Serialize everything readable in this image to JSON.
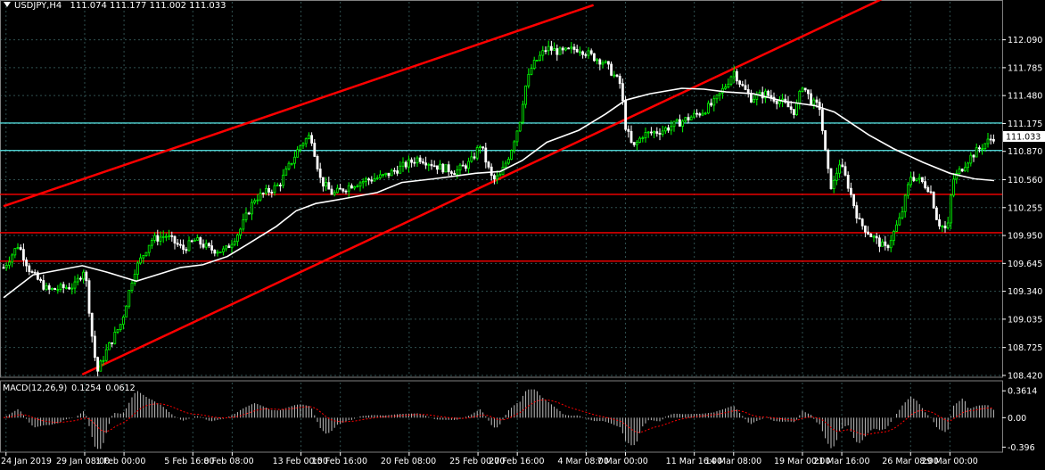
{
  "header": {
    "symbol": "USDJPY,H4",
    "open": "111.074",
    "high": "111.177",
    "low": "111.002",
    "close": "111.033"
  },
  "colors": {
    "background": "#000000",
    "grid": "#2f4f4f",
    "bull_candle": "#00ff00",
    "bear_candle": "#ffffff",
    "trendline": "#ff0000",
    "support": "#ff0000",
    "resistance": "#4fd1d1",
    "moving_average": "#ffffff",
    "macd_hist": "#c0c0c0",
    "macd_signal": "#ff0000",
    "text": "#ffffff",
    "price_tag": "#ffffff"
  },
  "chart_data": {
    "type": "candlestick",
    "symbol": "USDJPY",
    "timeframe": "H4",
    "y_ticks": [
      "112.090",
      "111.785",
      "111.480",
      "111.175",
      "110.870",
      "110.560",
      "110.255",
      "109.950",
      "109.645",
      "109.340",
      "109.035",
      "108.725",
      "108.420"
    ],
    "ylim": [
      108.4,
      112.33
    ],
    "x_ticks": [
      "24 Jan 2019",
      "29 Jan 08:00",
      "1 Feb 00:00",
      "5 Feb 16:00",
      "8 Feb 08:00",
      "13 Feb 00:00",
      "15 Feb 16:00",
      "20 Feb 08:00",
      "25 Feb 00:00",
      "27 Feb 16:00",
      "4 Mar 08:00",
      "7 Mar 00:00",
      "11 Mar 16:00",
      "14 Mar 08:00",
      "19 Mar 00:00",
      "21 Mar 16:00",
      "26 Mar 08:00",
      "29 Mar 00:00"
    ],
    "current_price_label": "111.033",
    "current_price": 111.033,
    "horizontal_levels": [
      {
        "price": 111.18,
        "kind": "resistance"
      },
      {
        "price": 110.88,
        "kind": "resistance"
      },
      {
        "price": 110.4,
        "kind": "support"
      },
      {
        "price": 109.98,
        "kind": "support"
      },
      {
        "price": 109.67,
        "kind": "support"
      }
    ],
    "trendlines": [
      {
        "from": [
          "23 Jan 20:00",
          110.27
        ],
        "to": [
          "4 Mar 20:00",
          112.47
        ]
      },
      {
        "from": [
          "29 Jan 04:00",
          108.43
        ],
        "to": [
          "25 Mar 12:00",
          112.62
        ]
      }
    ],
    "close_path": [
      [
        "23 Jan 20:00",
        109.6
      ],
      [
        "24 Jan 20:00",
        109.85
      ],
      [
        "25 Jan 16:00",
        109.55
      ],
      [
        "26 Jan 20:00",
        109.35
      ],
      [
        "28 Jan 16:00",
        109.4
      ],
      [
        "29 Jan 00:00",
        109.5
      ],
      [
        "29 Jan 08:00",
        109.6
      ],
      [
        "29 Jan 20:00",
        108.85
      ],
      [
        "30 Jan 04:00",
        108.45
      ],
      [
        "30 Jan 20:00",
        108.7
      ],
      [
        "31 Jan 20:00",
        109.0
      ],
      [
        "1 Feb 16:00",
        109.55
      ],
      [
        "2 Feb 20:00",
        109.9
      ],
      [
        "3 Feb 20:00",
        109.95
      ],
      [
        "5 Feb 00:00",
        109.8
      ],
      [
        "5 Feb 20:00",
        109.9
      ],
      [
        "6 Feb 20:00",
        109.8
      ],
      [
        "7 Feb 20:00",
        109.78
      ],
      [
        "8 Feb 20:00",
        110.0
      ],
      [
        "9 Feb 20:00",
        110.35
      ],
      [
        "11 Feb 12:00",
        110.5
      ],
      [
        "12 Feb 00:00",
        110.65
      ],
      [
        "13 Feb 00:00",
        110.95
      ],
      [
        "13 Feb 16:00",
        111.05
      ],
      [
        "14 Feb 08:00",
        110.55
      ],
      [
        "15 Feb 04:00",
        110.4
      ],
      [
        "16 Feb 08:00",
        110.5
      ],
      [
        "17 Feb 08:00",
        110.55
      ],
      [
        "18 Feb 16:00",
        110.6
      ],
      [
        "19 Feb 20:00",
        110.7
      ],
      [
        "21 Feb 00:00",
        110.8
      ],
      [
        "22 Feb 08:00",
        110.7
      ],
      [
        "23 Feb 12:00",
        110.65
      ],
      [
        "24 Feb 12:00",
        110.75
      ],
      [
        "25 Feb 04:00",
        110.95
      ],
      [
        "25 Feb 16:00",
        110.7
      ],
      [
        "26 Feb 00:00",
        110.55
      ],
      [
        "26 Feb 12:00",
        110.6
      ],
      [
        "27 Feb 04:00",
        110.85
      ],
      [
        "27 Feb 20:00",
        111.2
      ],
      [
        "28 Feb 04:00",
        111.55
      ],
      [
        "28 Feb 16:00",
        111.8
      ],
      [
        "1 Mar 16:00",
        112.0
      ],
      [
        "2 Mar 16:00",
        111.95
      ],
      [
        "3 Mar 20:00",
        112.0
      ],
      [
        "4 Mar 20:00",
        111.9
      ],
      [
        "5 Mar 12:00",
        111.85
      ],
      [
        "6 Mar 00:00",
        111.75
      ],
      [
        "6 Mar 16:00",
        111.6
      ],
      [
        "7 Mar 00:00",
        111.15
      ],
      [
        "7 Mar 12:00",
        110.9
      ],
      [
        "8 Mar 04:00",
        111.05
      ],
      [
        "9 Mar 12:00",
        111.1
      ],
      [
        "10 Mar 20:00",
        111.2
      ],
      [
        "12 Mar 04:00",
        111.3
      ],
      [
        "13 Mar 00:00",
        111.4
      ],
      [
        "13 Mar 20:00",
        111.6
      ],
      [
        "14 Mar 08:00",
        111.75
      ],
      [
        "14 Mar 20:00",
        111.6
      ],
      [
        "15 Mar 12:00",
        111.45
      ],
      [
        "16 Mar 12:00",
        111.5
      ],
      [
        "17 Mar 16:00",
        111.4
      ],
      [
        "18 Mar 12:00",
        111.3
      ],
      [
        "19 Mar 00:00",
        111.6
      ],
      [
        "19 Mar 16:00",
        111.4
      ],
      [
        "20 Mar 04:00",
        111.35
      ],
      [
        "20 Mar 16:00",
        110.7
      ],
      [
        "21 Mar 00:00",
        110.45
      ],
      [
        "21 Mar 12:00",
        110.75
      ],
      [
        "22 Mar 00:00",
        110.55
      ],
      [
        "22 Mar 20:00",
        110.1
      ],
      [
        "23 Mar 16:00",
        109.95
      ],
      [
        "24 Mar 16:00",
        109.8
      ],
      [
        "25 Mar 16:00",
        110.15
      ],
      [
        "26 Mar 08:00",
        110.6
      ],
      [
        "27 Mar 00:00",
        110.55
      ],
      [
        "27 Mar 16:00",
        110.45
      ],
      [
        "28 Mar 04:00",
        110.1
      ],
      [
        "28 Mar 20:00",
        110.0
      ],
      [
        "29 Mar 04:00",
        110.55
      ],
      [
        "30 Mar 08:00",
        110.8
      ],
      [
        "31 Mar 08:00",
        110.95
      ],
      [
        "1 Apr 00:00",
        111.03
      ]
    ],
    "moving_average": [
      [
        "23 Jan 20:00",
        109.27
      ],
      [
        "25 Jan 20:00",
        109.52
      ],
      [
        "29 Jan 04:00",
        109.62
      ],
      [
        "30 Jan 20:00",
        109.55
      ],
      [
        "1 Feb 20:00",
        109.45
      ],
      [
        "4 Feb 20:00",
        109.6
      ],
      [
        "6 Feb 08:00",
        109.63
      ],
      [
        "8 Feb 00:00",
        109.72
      ],
      [
        "9 Feb 08:00",
        109.85
      ],
      [
        "11 Feb 08:00",
        110.05
      ],
      [
        "12 Feb 16:00",
        110.22
      ],
      [
        "14 Feb 00:00",
        110.3
      ],
      [
        "15 Feb 20:00",
        110.35
      ],
      [
        "18 Feb 04:00",
        110.42
      ],
      [
        "19 Feb 20:00",
        110.53
      ],
      [
        "22 Feb 00:00",
        110.57
      ],
      [
        "24 Feb 20:00",
        110.63
      ],
      [
        "26 Feb 12:00",
        110.65
      ],
      [
        "28 Feb 00:00",
        110.77
      ],
      [
        "1 Mar 16:00",
        110.97
      ],
      [
        "3 Mar 20:00",
        111.1
      ],
      [
        "5 Mar 16:00",
        111.28
      ],
      [
        "7 Mar 00:00",
        111.43
      ],
      [
        "8 Mar 16:00",
        111.5
      ],
      [
        "10 Mar 20:00",
        111.56
      ],
      [
        "12 Mar 08:00",
        111.55
      ],
      [
        "13 Mar 20:00",
        111.52
      ],
      [
        "15 Mar 16:00",
        111.5
      ],
      [
        "17 Mar 16:00",
        111.42
      ],
      [
        "19 Mar 20:00",
        111.37
      ],
      [
        "21 Mar 04:00",
        111.3
      ],
      [
        "23 Mar 12:00",
        111.05
      ],
      [
        "25 Mar 04:00",
        110.9
      ],
      [
        "27 Mar 04:00",
        110.75
      ],
      [
        "29 Mar 00:00",
        110.63
      ],
      [
        "30 Mar 16:00",
        110.57
      ],
      [
        "1 Apr 00:00",
        110.55
      ]
    ],
    "macd": {
      "label": "MACD(12,26,9)",
      "main": "0.1254",
      "signal": "0.0612",
      "y_ticks": [
        "0.3614",
        "0.00",
        "-0.396"
      ],
      "ylim": [
        -0.44,
        0.4
      ]
    }
  }
}
